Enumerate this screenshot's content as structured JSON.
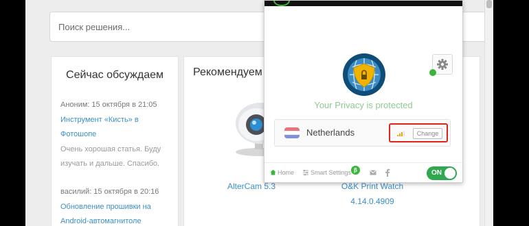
{
  "search": {
    "placeholder": "Поиск решения..."
  },
  "discussing": {
    "title": "Сейчас обсуждаем",
    "comments": [
      {
        "author": "Аноним: 15 октября в 21:05",
        "link_lines": [
          "Инструмент «Кисть» в",
          "Фотошопе"
        ],
        "text_lines": [
          "Очень хорошая статья. Буду",
          "изучать и дальше. Спасибо."
        ]
      },
      {
        "author": "василий: 15 октября в 20:16",
        "link_lines": [
          "Обновление прошивки на",
          "Android-автомагнитоле"
        ],
        "text_lines": []
      }
    ]
  },
  "recommended": {
    "title": "Рекомендуем",
    "apps": [
      {
        "name": "AlterCam 5.3",
        "version": ""
      },
      {
        "name": "O&K Print Watch",
        "version": "4.14.0.4909"
      }
    ]
  },
  "vpn": {
    "status": "Your Privacy is protected",
    "country": "Netherlands",
    "change_label": "Change",
    "flag_colors": [
      "#e8737a",
      "#ffffff",
      "#7f8fd9"
    ],
    "footer": {
      "home": "Home",
      "smart_settings": "Smart Settings",
      "beta": "β",
      "toggle": "ON"
    }
  },
  "colors": {
    "accent_green": "#2fa84f",
    "link_blue": "#3b8fc5",
    "highlight_red": "#e2231a"
  }
}
